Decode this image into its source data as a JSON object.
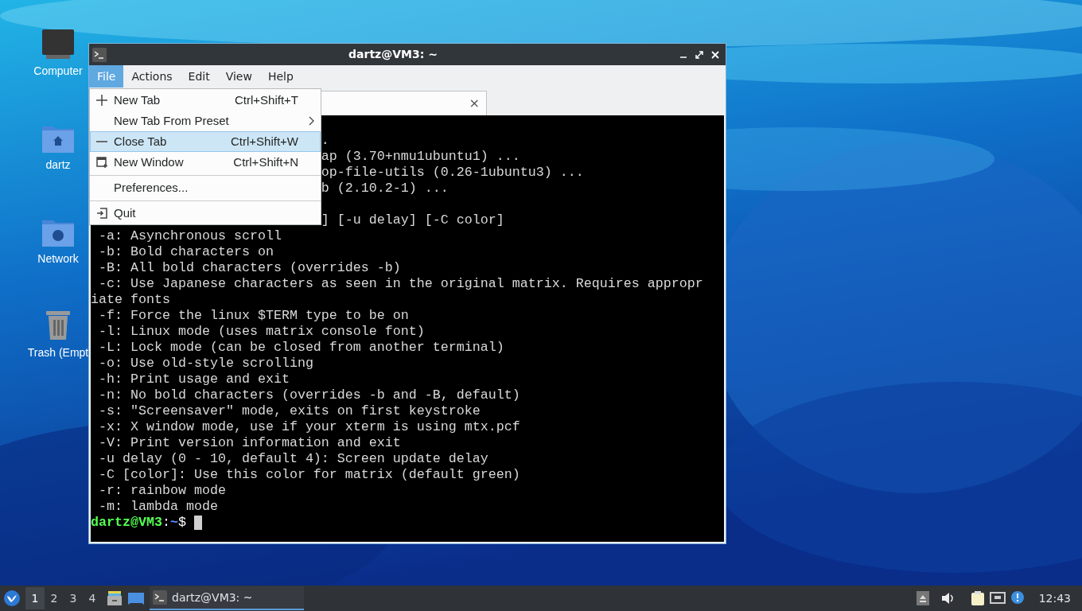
{
  "desktop_icons": [
    {
      "kind": "computer",
      "label": "Computer"
    },
    {
      "kind": "home",
      "label": "dartz"
    },
    {
      "kind": "network",
      "label": "Network"
    },
    {
      "kind": "trash",
      "label": "Trash (Empt"
    }
  ],
  "window": {
    "title": "dartz@VM3: ~"
  },
  "menubar": [
    {
      "label": "File",
      "selected": true
    },
    {
      "label": "Actions",
      "selected": false
    },
    {
      "label": "Edit",
      "selected": false
    },
    {
      "label": "View",
      "selected": false
    },
    {
      "label": "Help",
      "selected": false
    }
  ],
  "file_menu": [
    {
      "kind": "add",
      "label": "New Tab",
      "shortcut": "Ctrl+Shift+T",
      "selected": false
    },
    {
      "kind": "submenu",
      "label": "New Tab From Preset",
      "selected": false
    },
    {
      "kind": "remove",
      "label": "Close Tab",
      "shortcut": "Ctrl+Shift+W",
      "selected": true
    },
    {
      "kind": "window",
      "label": "New Window",
      "shortcut": "Ctrl+Shift+N",
      "selected": false
    },
    {
      "kind": "separator"
    },
    {
      "kind": "plain",
      "label": "Preferences...",
      "selected": false
    },
    {
      "kind": "separator"
    },
    {
      "kind": "exit",
      "label": "Quit",
      "selected": false
    }
  ],
  "tab": {
    "close": "×"
  },
  "terminal": {
    "lines": [
      {
        "kind": "partial",
        "text": "."
      },
      {
        "kind": "partial",
        "text": "ap (3.70+nmu1ubuntu1) ..."
      },
      {
        "kind": "partial",
        "text": "op-file-utils (0.26-1ubuntu3) ..."
      },
      {
        "kind": "partial",
        "text": "b (2.10.2-1) ..."
      },
      {
        "kind": "blank"
      },
      {
        "kind": "partial",
        "text": "] [-u delay] [-C color]"
      },
      {
        "kind": "line",
        "text": " -a: Asynchronous scroll"
      },
      {
        "kind": "line",
        "text": " -b: Bold characters on"
      },
      {
        "kind": "line",
        "text": " -B: All bold characters (overrides -b)"
      },
      {
        "kind": "line",
        "text": " -c: Use Japanese characters as seen in the original matrix. Requires appropr"
      },
      {
        "kind": "line",
        "text": "iate fonts"
      },
      {
        "kind": "line",
        "text": " -f: Force the linux $TERM type to be on"
      },
      {
        "kind": "line",
        "text": " -l: Linux mode (uses matrix console font)"
      },
      {
        "kind": "line",
        "text": " -L: Lock mode (can be closed from another terminal)"
      },
      {
        "kind": "line",
        "text": " -o: Use old-style scrolling"
      },
      {
        "kind": "line",
        "text": " -h: Print usage and exit"
      },
      {
        "kind": "line",
        "text": " -n: No bold characters (overrides -b and -B, default)"
      },
      {
        "kind": "line",
        "text": " -s: \"Screensaver\" mode, exits on first keystroke"
      },
      {
        "kind": "line",
        "text": " -x: X window mode, use if your xterm is using mtx.pcf"
      },
      {
        "kind": "line",
        "text": " -V: Print version information and exit"
      },
      {
        "kind": "line",
        "text": " -u delay (0 - 10, default 4): Screen update delay"
      },
      {
        "kind": "line",
        "text": " -C [color]: Use this color for matrix (default green)"
      },
      {
        "kind": "line",
        "text": " -r: rainbow mode"
      },
      {
        "kind": "line",
        "text": " -m: lambda mode"
      }
    ],
    "prompt": {
      "user_host": "dartz@VM3",
      "colon": ":",
      "path": "~",
      "symbol": "$"
    }
  },
  "taskbar": {
    "workspaces": [
      {
        "label": "1",
        "selected": true
      },
      {
        "label": "2",
        "selected": false
      },
      {
        "label": "3",
        "selected": false
      },
      {
        "label": "4",
        "selected": false
      }
    ],
    "tasks": [
      {
        "label": "dartz@VM3: ~",
        "selected": true
      }
    ],
    "clock": "12:43"
  }
}
